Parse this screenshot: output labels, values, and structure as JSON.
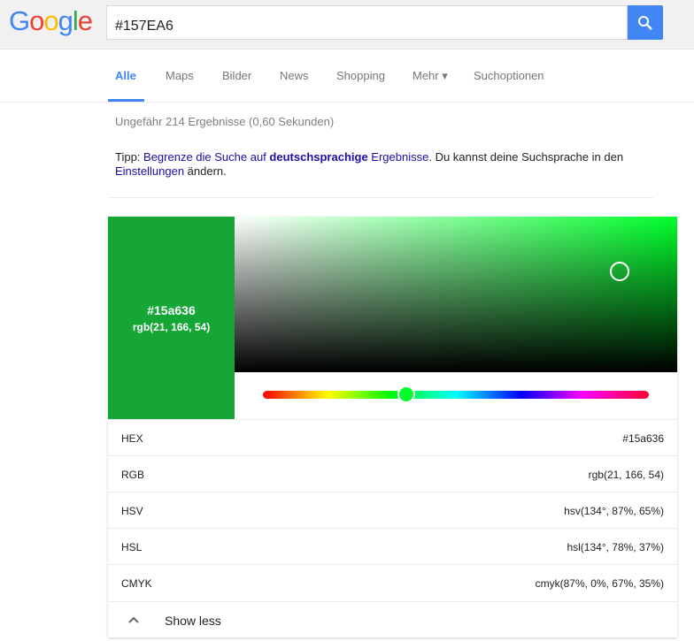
{
  "header": {
    "logo": "Google",
    "query": "#157EA6",
    "search_icon": "search-icon"
  },
  "tabs": [
    {
      "label": "Alle",
      "active": true
    },
    {
      "label": "Maps"
    },
    {
      "label": "Bilder"
    },
    {
      "label": "News"
    },
    {
      "label": "Shopping"
    },
    {
      "label": "Mehr ▾"
    },
    {
      "label": "Suchoptionen"
    }
  ],
  "stats": "Ungefähr 214 Ergebnisse (0,60 Sekunden)",
  "tip": {
    "prefix": "Tipp: ",
    "link1": "Begrenze die Suche auf ",
    "bold": "deutschsprachige",
    "link2": " Ergebnisse",
    "mid": ". Du kannst deine Suchsprache in den ",
    "link3": "Einstellungen",
    "suffix": " ändern."
  },
  "color": {
    "hex": "#15a636",
    "rgb": "rgb(21, 166, 54)",
    "swatch": "#15a636",
    "hue_color": "#00ff2b",
    "hue_deg": 134,
    "saturation": 87,
    "value": 65
  },
  "rows": [
    {
      "k": "HEX",
      "v": "#15a636"
    },
    {
      "k": "RGB",
      "v": "rgb(21, 166, 54)"
    },
    {
      "k": "HSV",
      "v": "hsv(134°, 87%, 65%)"
    },
    {
      "k": "HSL",
      "v": "hsl(134°, 78%, 37%)"
    },
    {
      "k": "CMYK",
      "v": "cmyk(87%, 0%, 67%, 35%)"
    }
  ],
  "show_less": "Show less"
}
